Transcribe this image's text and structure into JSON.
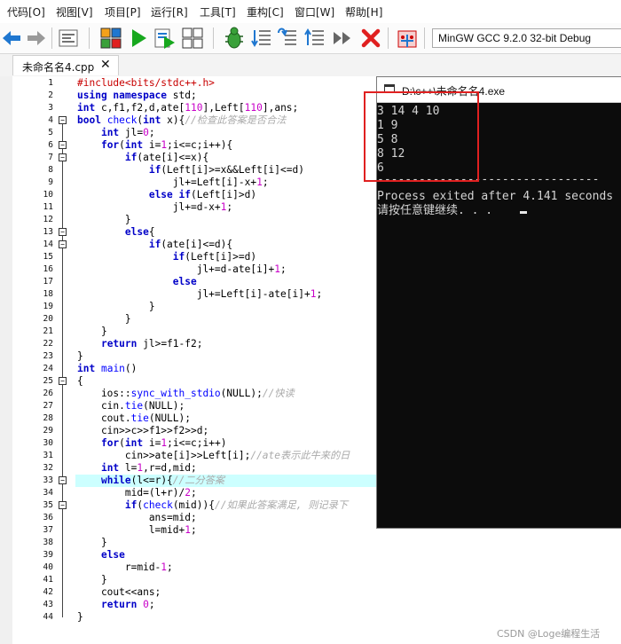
{
  "menubar": {
    "items": [
      "代码[O]",
      "视图[V]",
      "项目[P]",
      "运行[R]",
      "工具[T]",
      "重构[C]",
      "窗口[W]",
      "帮助[H]"
    ]
  },
  "toolbar": {
    "compiler": "MinGW GCC 9.2.0 32-bit Debug",
    "buttons": [
      "back-arrow-icon",
      "forward-arrow-icon",
      "format-code-icon",
      "compile-icon",
      "run-icon",
      "compile-run-icon",
      "rebuild-icon",
      "debug-icon",
      "step-into-icon",
      "step-over-icon",
      "step-out-icon",
      "continue-icon",
      "stop-icon",
      "profile-icon"
    ],
    "colors": {
      "run": "#17a81e",
      "debug": "#3aa13a",
      "stop": "#e02020",
      "compile_a": "#f4a11a",
      "compile_b": "#1f77d0"
    }
  },
  "tab": {
    "filename": "未命名名4.cpp",
    "close": "✕"
  },
  "editor": {
    "highlight_line": 33,
    "fold_markers": [
      4,
      6,
      7,
      13,
      14,
      25,
      33,
      35
    ],
    "highlight_color": "#ccffff"
  },
  "console": {
    "title": "D:\\c++\\未命名名4.exe",
    "lines": [
      "3 14 4 10",
      "1 9",
      "5 8",
      "8 12",
      "6"
    ],
    "separator": "--------------------------------",
    "process_line": "Process exited after 4.141 seconds",
    "prompt_line": "请按任意键继续. . . "
  },
  "watermark": "CSDN @Loge编程生活"
}
